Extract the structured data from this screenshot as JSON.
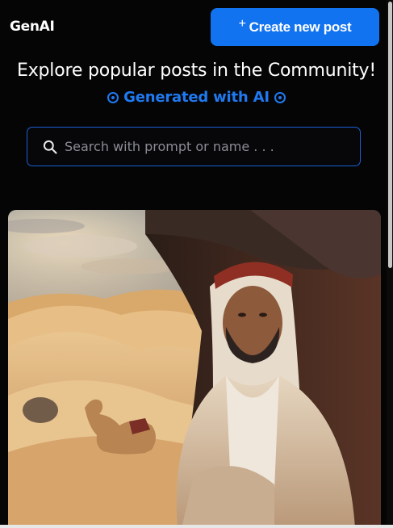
{
  "nav": {
    "logo": "GenAI",
    "create_button_icon": "plus-icon",
    "create_button_label": "Create new post"
  },
  "hero": {
    "title": "Explore popular posts in the Community!",
    "subtitle": "Generated with AI",
    "accent_color": "#1f7af2"
  },
  "search": {
    "placeholder": "Search with prompt or name . . .",
    "value": ""
  },
  "posts": [
    {
      "image_description_icon": "ai-generated-image"
    }
  ],
  "colors": {
    "background": "#050506",
    "primary_button": "#1273f0",
    "search_border": "#1a5fd0"
  }
}
